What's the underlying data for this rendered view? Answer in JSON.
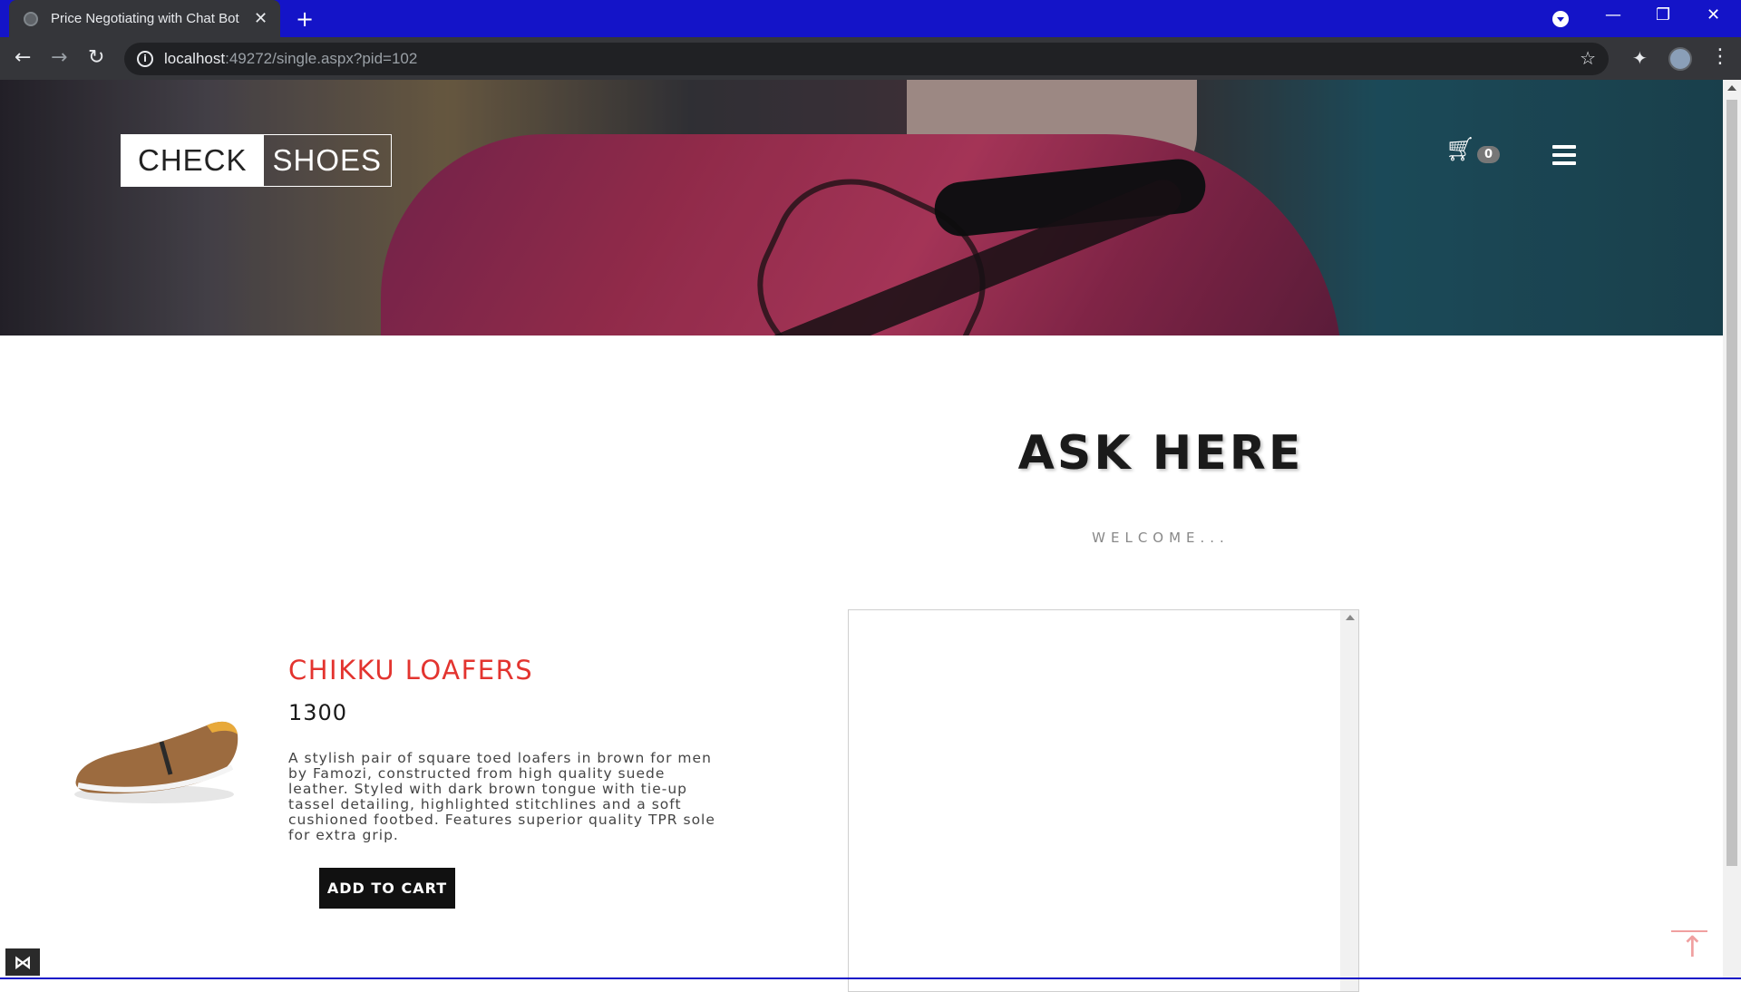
{
  "browser": {
    "tab_title": "Price Negotiating with Chat Bot",
    "url_host": "localhost",
    "url_rest": ":49272/single.aspx?pid=102"
  },
  "header": {
    "logo_left": "CHECK",
    "logo_right": "SHOES",
    "cart_count": "0"
  },
  "chat": {
    "title": "ASK HERE",
    "subtitle": "WELCOME..."
  },
  "product": {
    "name": "CHIKKU LOAFERS",
    "price": "1300",
    "description": "A stylish pair of square toed loafers in brown for men by Famozi, constructed from high quality suede leather. Styled with dark brown tongue with tie-up tassel detailing, highlighted stitchlines and a soft cushioned footbed. Features superior quality TPR sole for extra grip.",
    "add_to_cart_label": "ADD TO CART"
  },
  "colors": {
    "accent_red": "#e3342f",
    "browser_frame": "#1414c8"
  },
  "icons": [
    "tab-favicon",
    "close-icon",
    "plus-icon",
    "back-icon",
    "forward-icon",
    "reload-icon",
    "info-icon",
    "star-icon",
    "extensions-icon",
    "profile-avatar",
    "menu-icon",
    "cart-icon",
    "hamburger-icon",
    "scroll-top-icon"
  ]
}
